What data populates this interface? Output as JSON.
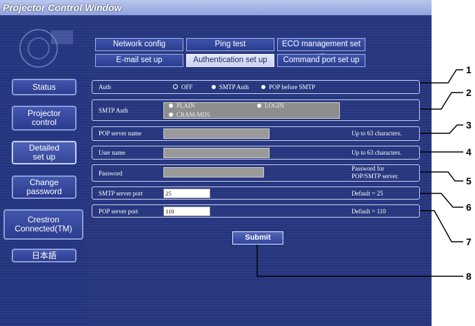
{
  "window": {
    "title": "Projector Control Window"
  },
  "sidebar": {
    "items": [
      {
        "label": "Status"
      },
      {
        "label": "Projector control"
      },
      {
        "label": "Detailed set up"
      },
      {
        "label": "Change password"
      },
      {
        "label": "Crestron Connected(TM)"
      },
      {
        "label": "日本語"
      }
    ]
  },
  "tabs": [
    {
      "label": "Network config"
    },
    {
      "label": "Ping test"
    },
    {
      "label": "ECO management set up"
    },
    {
      "label": "E-mail set up"
    },
    {
      "label": "Authentication set up"
    },
    {
      "label": "Command port set up"
    }
  ],
  "form": {
    "auth": {
      "label": "Auth",
      "options": [
        "OFF",
        "SMTP Auth",
        "POP before SMTP"
      ],
      "selected": "OFF"
    },
    "smtp_auth": {
      "label": "SMTP Auth",
      "options": [
        "PLAIN",
        "LOGIN",
        "CRAM-MD5"
      ]
    },
    "pop_server_name": {
      "label": "POP server name",
      "value": "",
      "hint": "Up to 63 characters."
    },
    "user_name": {
      "label": "User name",
      "value": "",
      "hint": "Up to 63 characters."
    },
    "password": {
      "label": "Password",
      "value": "",
      "hint_line1": "Password for",
      "hint_line2": "POP/SMTP server."
    },
    "smtp_port": {
      "label": "SMTP server port",
      "value": "25",
      "hint": "Default = 25"
    },
    "pop_port": {
      "label": "POP server port",
      "value": "110",
      "hint": "Default = 110"
    },
    "submit_label": "Submit"
  },
  "callouts": [
    "1",
    "2",
    "3",
    "4",
    "5",
    "6",
    "7",
    "8"
  ]
}
